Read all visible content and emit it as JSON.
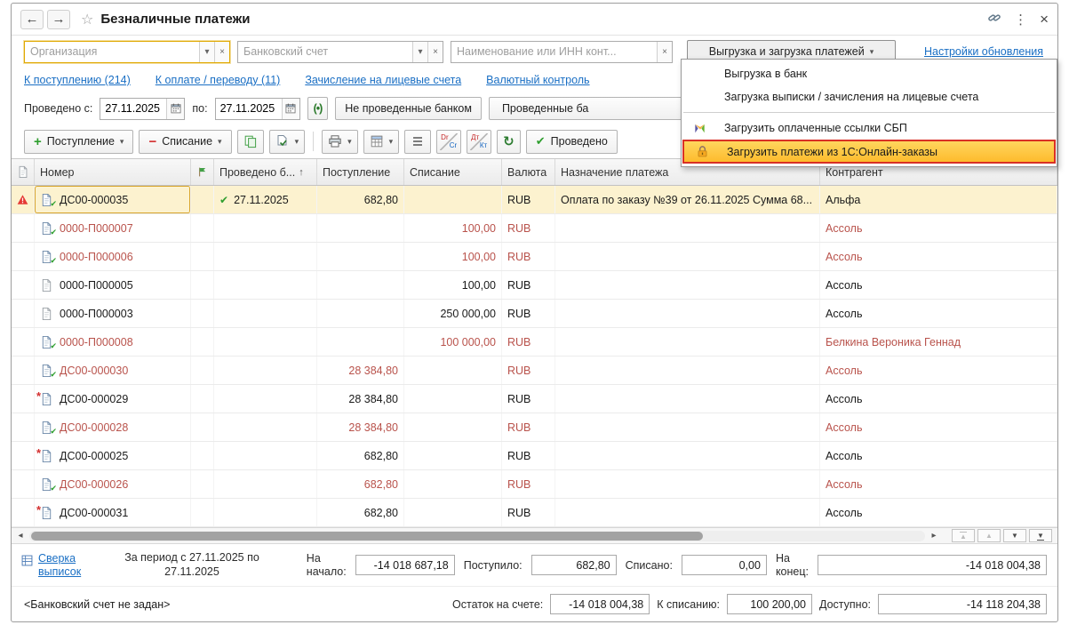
{
  "titlebar": {
    "title": "Безналичные платежи"
  },
  "icons": {
    "back": "←",
    "forward": "→",
    "favorite": "☆",
    "kebab": "⋮",
    "close": "×",
    "combo_arrow": "▾",
    "clear": "×",
    "dropdown_arrow": "▾",
    "sort_asc": "↑",
    "plus": "+",
    "minus": "−",
    "refresh": "↻",
    "check": "✔",
    "posted_check": "✔",
    "marked_cross": "*",
    "interval": "(•)",
    "scroll_left": "◂",
    "scroll_right": "▸",
    "nav_up": "▲",
    "nav_down": "▼"
  },
  "colors": {
    "highlight_bg": "#fdbb2d",
    "highlight_border": "#d93025",
    "selected_row_bg": "#fcf2cf",
    "link_color": "#1a6fc4",
    "negative_text": "#b9534c"
  },
  "filters": {
    "organization_placeholder": "Организация",
    "bank_account_placeholder": "Банковский счет",
    "counterparty_placeholder": "Наименование или ИНН конт...",
    "exchange_button": "Выгрузка и загрузка платежей",
    "settings_link": "Настройки обновления"
  },
  "quick_links": [
    {
      "label": "К поступлению (214)"
    },
    {
      "label": "К оплате / переводу (11)"
    },
    {
      "label": "Зачисление на лицевые счета"
    },
    {
      "label": "Валютный контроль"
    }
  ],
  "period": {
    "from_label": "Проведено с:",
    "from": "27.11.2025",
    "to_label": "по:",
    "to": "27.11.2025",
    "not_processed_button": "Не проведенные банком",
    "processed_button": "Проведенные ба"
  },
  "toolbar": {
    "receipt": "Поступление",
    "writeoff": "Списание",
    "processed": "Проведено",
    "drcr_en_top": "Dr",
    "drcr_en_bottom": "Cr",
    "drcr_ru_top": "Дт",
    "drcr_ru_bottom": "Кт"
  },
  "dropdown_menu": {
    "items": [
      {
        "label": "Выгрузка в банк"
      },
      {
        "label": "Загрузка выписки / зачисления на лицевые счета"
      },
      {
        "label": "Загрузить оплаченные ссылки СБП",
        "icon": "sbp-icon"
      },
      {
        "label": "Загрузить платежи из 1С:Онлайн-заказы",
        "icon": "online-orders-icon",
        "highlighted": true
      }
    ]
  },
  "table": {
    "headers": {
      "number": "Номер",
      "processed": "Проведено б...",
      "receipt": "Поступление",
      "writeoff": "Списание",
      "currency": "Валюта",
      "purpose": "Назначение платежа",
      "counterparty": "Контрагент"
    },
    "rows": [
      {
        "number": "ДС00-000035",
        "processed_date": "27.11.2025",
        "receipt": "682,80",
        "writeoff": "",
        "currency": "RUB",
        "purpose": "Оплата по заказу №39 от 26.11.2025 Сумма 68...",
        "counterparty": "Альфа",
        "doc_icon": "doc-posted-icon",
        "warning": true,
        "selected": true,
        "color": "black"
      },
      {
        "number": "0000-П000007",
        "processed_date": "",
        "receipt": "",
        "writeoff": "100,00",
        "currency": "RUB",
        "purpose": "",
        "counterparty": "Ассоль",
        "doc_icon": "doc-posted-icon",
        "color": "red"
      },
      {
        "number": "0000-П000006",
        "processed_date": "",
        "receipt": "",
        "writeoff": "100,00",
        "currency": "RUB",
        "purpose": "",
        "counterparty": "Ассоль",
        "doc_icon": "doc-posted-icon",
        "color": "red"
      },
      {
        "number": "0000-П000005",
        "processed_date": "",
        "receipt": "",
        "writeoff": "100,00",
        "currency": "RUB",
        "purpose": "",
        "counterparty": "Ассоль",
        "doc_icon": "doc-plain-icon",
        "color": "black"
      },
      {
        "number": "0000-П000003",
        "processed_date": "",
        "receipt": "",
        "writeoff": "250 000,00",
        "currency": "RUB",
        "purpose": "",
        "counterparty": "Ассоль",
        "doc_icon": "doc-plain-icon",
        "color": "black"
      },
      {
        "number": "0000-П000008",
        "processed_date": "",
        "receipt": "",
        "writeoff": "100 000,00",
        "currency": "RUB",
        "purpose": "",
        "counterparty": "Белкина Вероника Геннад",
        "doc_icon": "doc-posted-icon",
        "color": "red"
      },
      {
        "number": "ДС00-000030",
        "processed_date": "",
        "receipt": "28 384,80",
        "writeoff": "",
        "currency": "RUB",
        "purpose": "",
        "counterparty": "Ассоль",
        "doc_icon": "doc-posted-icon",
        "color": "red"
      },
      {
        "number": "ДС00-000029",
        "processed_date": "",
        "receipt": "28 384,80",
        "writeoff": "",
        "currency": "RUB",
        "purpose": "",
        "counterparty": "Ассоль",
        "doc_icon": "doc-marked-icon",
        "color": "black"
      },
      {
        "number": "ДС00-000028",
        "processed_date": "",
        "receipt": "28 384,80",
        "writeoff": "",
        "currency": "RUB",
        "purpose": "",
        "counterparty": "Ассоль",
        "doc_icon": "doc-posted-icon",
        "color": "red"
      },
      {
        "number": "ДС00-000025",
        "processed_date": "",
        "receipt": "682,80",
        "writeoff": "",
        "currency": "RUB",
        "purpose": "",
        "counterparty": "Ассоль",
        "doc_icon": "doc-marked-icon",
        "color": "black"
      },
      {
        "number": "ДС00-000026",
        "processed_date": "",
        "receipt": "682,80",
        "writeoff": "",
        "currency": "RUB",
        "purpose": "",
        "counterparty": "Ассоль",
        "doc_icon": "doc-posted-icon",
        "color": "red"
      },
      {
        "number": "ДС00-000031",
        "processed_date": "",
        "receipt": "682,80",
        "writeoff": "",
        "currency": "RUB",
        "purpose": "",
        "counterparty": "Ассоль",
        "doc_icon": "doc-marked-icon",
        "color": "black"
      }
    ]
  },
  "footer": {
    "reconcile_link1": "Сверка",
    "reconcile_link2": "выписок",
    "period_line1": "За период с 27.11.2025 по",
    "period_line2": "27.11.2025",
    "begin_label1": "На",
    "begin_label2": "начало:",
    "begin_value": "-14 018 687,18",
    "received_label": "Поступило:",
    "received_value": "682,80",
    "written_label": "Списано:",
    "written_value": "0,00",
    "end_label1": "На",
    "end_label2": "конец:",
    "end_value": "-14 018 004,38"
  },
  "statusbar": {
    "account_hint": "<Банковский счет не задан>",
    "balance_label": "Остаток на счете:",
    "balance_value": "-14 018 004,38",
    "to_writeoff_label": "К списанию:",
    "to_writeoff_value": "100 200,00",
    "available_label": "Доступно:",
    "available_value": "-14 118 204,38"
  }
}
